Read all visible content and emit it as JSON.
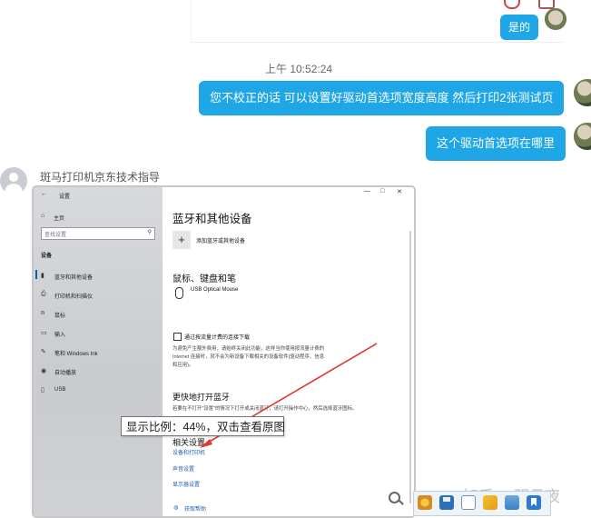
{
  "chat": {
    "reply_1": "是的",
    "timestamp": "上午 10:52:24",
    "msg_2": "您不校正的话 可以设置好驱动首选项宽度高度 然后打印2张测试页",
    "msg_3": "这个驱动首选项在哪里",
    "sender_name": "斑马打印机京东技术指导"
  },
  "screenshot": {
    "window_title": "设置",
    "window_controls": [
      "—",
      "□",
      "✕"
    ],
    "home": "主页",
    "search_placeholder": "查找设置",
    "section": "设备",
    "nav": [
      {
        "icon": "bluetooth-icon",
        "glyph": "▮",
        "label": "蓝牙和其他设备"
      },
      {
        "icon": "printer-icon",
        "glyph": "⎙",
        "label": "打印机和扫描仪"
      },
      {
        "icon": "mouse-icon",
        "glyph": "⍝",
        "label": "鼠标"
      },
      {
        "icon": "keyboard-icon",
        "glyph": "▭",
        "label": "输入"
      },
      {
        "icon": "pen-icon",
        "glyph": "✎",
        "label": "笔和 Windows Ink"
      },
      {
        "icon": "autoplay-icon",
        "glyph": "◉",
        "label": "自动播放"
      },
      {
        "icon": "usb-icon",
        "glyph": "▯",
        "label": "USB"
      }
    ],
    "page_title": "蓝牙和其他设备",
    "add_device": "添加蓝牙或其他设备",
    "mouse_section": "鼠标、键盘和笔",
    "usb_mouse": "USB Optical Mouse",
    "metered_label": "通过按流量计费的连接下载",
    "metered_desc_1": "为避免产生额外费用，请始终关闭此功能，这样当你使用按流量计费的",
    "metered_desc_2": "Internet 连接时，就不会为新设备下载相关的设备软件(驱动程序、信息",
    "metered_desc_3": "和应用)。",
    "quick_bt_title": "更快地打开蓝牙",
    "quick_bt_desc": "若要在不打开\"设置\"的情况下打开或关闭蓝牙，请打开操作中心，然后选择蓝牙图标。",
    "related_title": "相关设置",
    "related_links": [
      "设备和打印机",
      "声音设置",
      "显示器设置"
    ],
    "help": "获取帮助"
  },
  "tooltip": "显示比例：44%，双击查看原图",
  "watermark": "知乎 @明月夜"
}
